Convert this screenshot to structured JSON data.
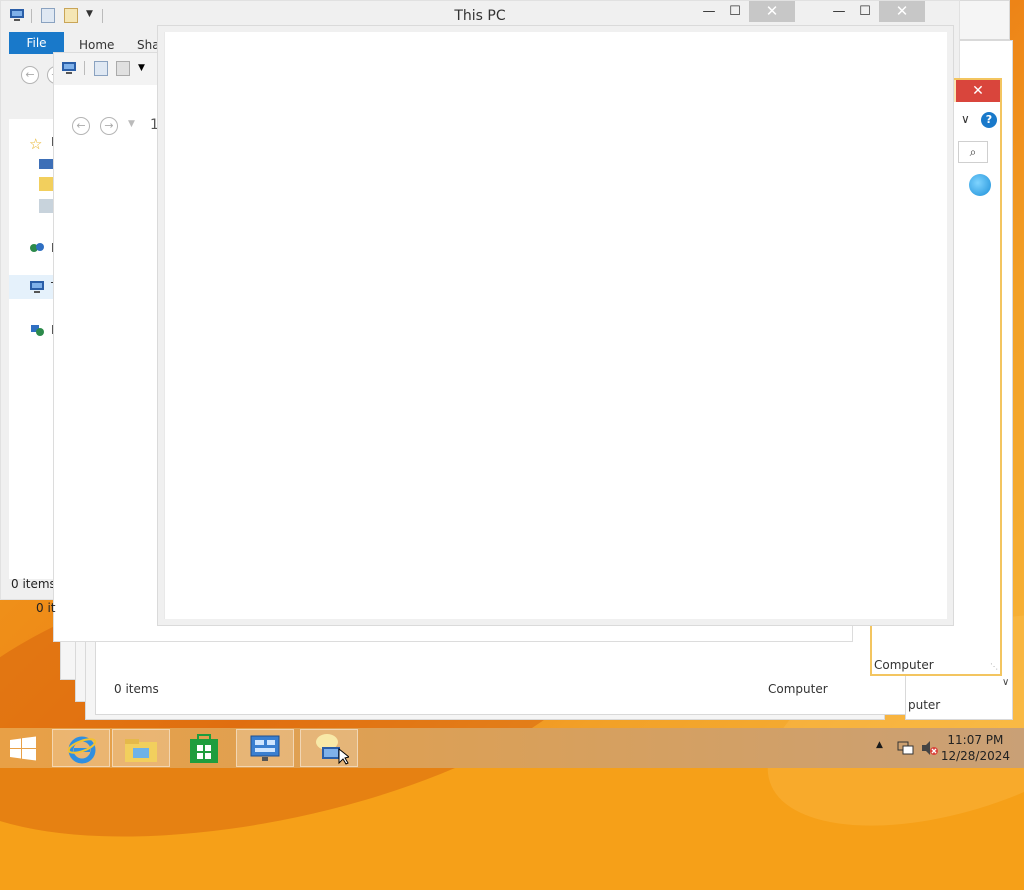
{
  "main_window": {
    "title": "This PC",
    "tabs": {
      "file": "File",
      "home": "Home",
      "share": "Sha"
    },
    "nav_items": [
      "F",
      "",
      "",
      "",
      "N",
      "T",
      "N"
    ],
    "status": "0 items",
    "caption": {
      "minimize": "—",
      "maximize": "☐",
      "close": "✕"
    }
  },
  "second_window": {
    "status": "0 it",
    "crumb": "1"
  },
  "back_windows": {
    "status_items": "0 items",
    "status_computer": "Computer",
    "status_computer_2": "Computer",
    "status_computer_3": "puter"
  },
  "right_window": {
    "close": "✕",
    "help": "?",
    "search_glyph": "⌕",
    "chevron": "∨"
  },
  "taskbar": {
    "apps": [
      "start",
      "internet-explorer",
      "file-explorer",
      "store",
      "server-manager",
      "network-explorer"
    ],
    "clock_time": "11:07 PM",
    "clock_date": "12/28/2024"
  },
  "colors": {
    "file_tab": "#1979ca",
    "close_red": "#d9453c",
    "desktop": "#f0931a"
  }
}
